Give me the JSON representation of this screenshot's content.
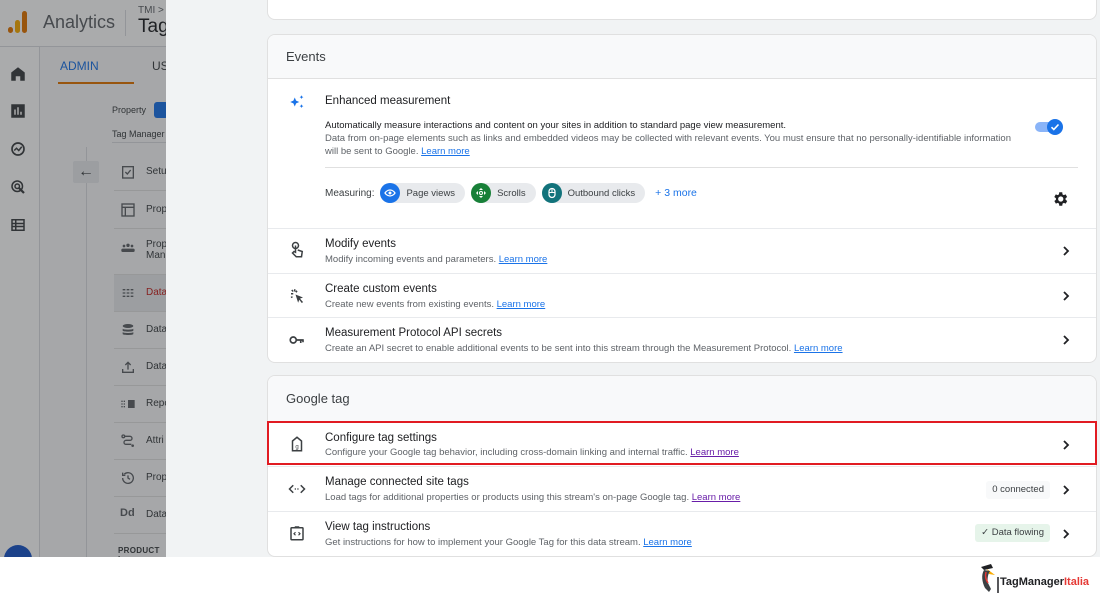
{
  "background_app": {
    "app_name": "Analytics",
    "breadcrumb": "TMI >",
    "page_title": "Tag",
    "tabs": [
      {
        "label": "ADMIN",
        "active": true
      },
      {
        "label": "US"
      }
    ],
    "property_label": "Property",
    "account_label": "Tag Manager",
    "rail_icons": [
      "home-icon",
      "reports-icon",
      "explore-icon",
      "advertising-icon",
      "configure-icon"
    ],
    "menu_items": [
      {
        "label": "Setu",
        "icon": "setup-assistant-icon"
      },
      {
        "label": "Prop",
        "icon": "property-settings-icon"
      },
      {
        "label": "Prop\nMan",
        "icon": "property-access-icon"
      },
      {
        "label": "Data",
        "icon": "data-streams-icon",
        "active": true
      },
      {
        "label": "Data",
        "icon": "data-settings-icon"
      },
      {
        "label": "Data",
        "icon": "data-import-icon"
      },
      {
        "label": "Repo",
        "icon": "reporting-identity-icon"
      },
      {
        "label": "Attri",
        "icon": "attribution-icon"
      },
      {
        "label": "Prop",
        "icon": "property-history-icon"
      },
      {
        "label": "Data",
        "icon": "data-deletion-icon"
      }
    ],
    "product_links_label": "PRODUCT L"
  },
  "events": {
    "heading": "Events",
    "enhanced_measurement": {
      "title": "Enhanced measurement",
      "body_line1": "Automatically measure interactions and content on your sites in addition to standard page view measurement.",
      "body_line2": "Data from on-page elements such as links and embedded videos may be collected with relevant events. You must ensure that no personally-identifiable information will be sent to Google.",
      "learn_more": "Learn more",
      "enabled": true,
      "measuring_label": "Measuring:",
      "chips": [
        {
          "label": "Page views",
          "icon": "eye-icon",
          "color": "#1a73e8"
        },
        {
          "label": "Scrolls",
          "icon": "scroll-icon",
          "color": "#188038"
        },
        {
          "label": "Outbound clicks",
          "icon": "mouse-icon",
          "color": "#12737b"
        }
      ],
      "more": "+ 3 more"
    },
    "rows": [
      {
        "title": "Modify events",
        "desc": "Modify incoming events and parameters.",
        "learn_more": "Learn more"
      },
      {
        "title": "Create custom events",
        "desc": "Create new events from existing events.",
        "learn_more": "Learn more"
      },
      {
        "title": "Measurement Protocol API secrets",
        "desc": "Create an API secret to enable additional events to be sent into this stream through the Measurement Protocol.",
        "learn_more": "Learn more"
      }
    ]
  },
  "google_tag": {
    "heading": "Google tag",
    "rows": [
      {
        "title": "Configure tag settings",
        "desc": "Configure your Google tag behavior, including cross-domain linking and internal traffic.",
        "learn_more": "Learn more",
        "highlighted": true
      },
      {
        "title": "Manage connected site tags",
        "desc": "Load tags for additional properties or products using this stream's on-page Google tag.",
        "learn_more": "Learn more",
        "badge": "0 connected"
      },
      {
        "title": "View tag instructions",
        "desc": "Get instructions for how to implement your Google Tag for this data stream.",
        "learn_more": "Learn more",
        "badge": "✓ Data flowing"
      }
    ]
  },
  "branding": {
    "name_part1": "TagManager",
    "name_part2": "Italia"
  },
  "colors": {
    "accent": "#1a73e8",
    "highlight_border": "#e11b22",
    "active_tab": "#e37400"
  }
}
